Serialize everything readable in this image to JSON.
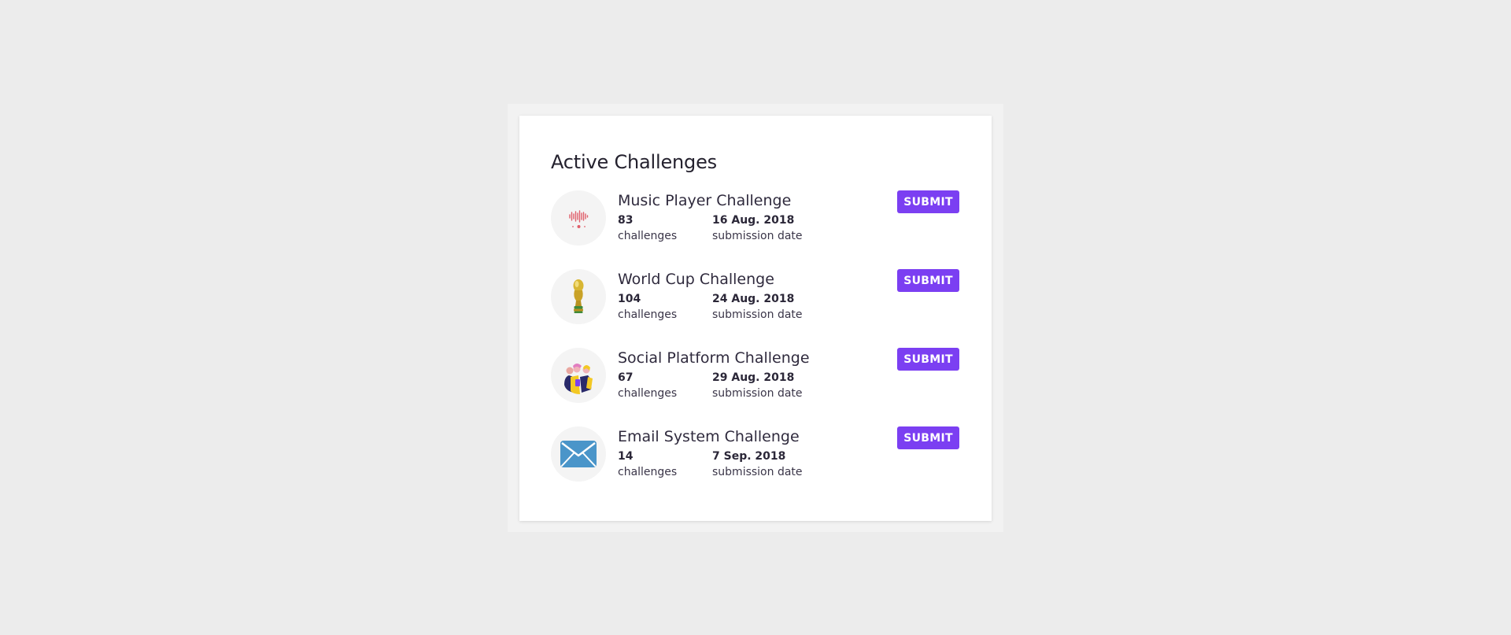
{
  "card": {
    "title": "Active Challenges"
  },
  "challenges": [
    {
      "name": "Music Player Challenge",
      "count": "83",
      "count_label": "challenges",
      "date": "16 Aug. 2018",
      "date_label": "submission date",
      "icon": "soundwave-icon",
      "action_label": "SUBMIT"
    },
    {
      "name": "World Cup Challenge",
      "count": "104",
      "count_label": "challenges",
      "date": "24 Aug. 2018",
      "date_label": "submission date",
      "icon": "trophy-icon",
      "action_label": "SUBMIT"
    },
    {
      "name": "Social Platform Challenge",
      "count": "67",
      "count_label": "challenges",
      "date": "29 Aug. 2018",
      "date_label": "submission date",
      "icon": "people-illustration-icon",
      "action_label": "SUBMIT"
    },
    {
      "name": "Email System Challenge",
      "count": "14",
      "count_label": "challenges",
      "date": "7 Sep. 2018",
      "date_label": "submission date",
      "icon": "envelope-icon",
      "action_label": "SUBMIT"
    }
  ],
  "colors": {
    "accent": "#7b3ff2",
    "page_background": "#ececec",
    "card_background": "#ffffff",
    "avatar_background": "#f4f4f4"
  }
}
